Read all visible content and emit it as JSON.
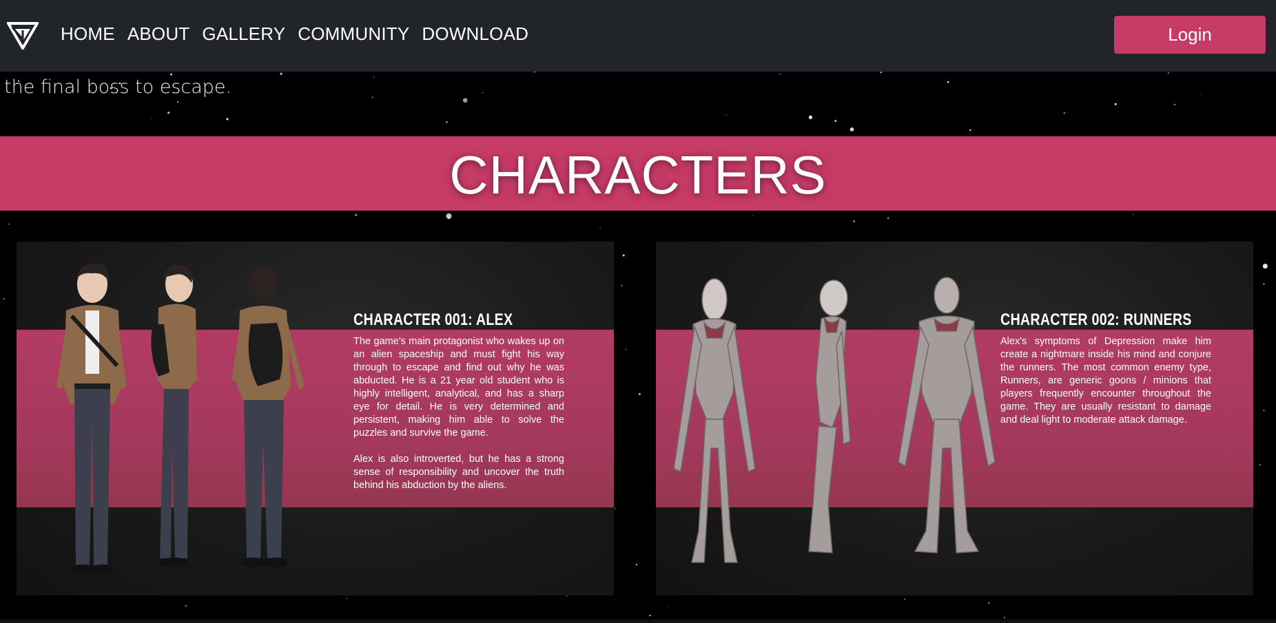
{
  "navbar": {
    "logo_icon": "stylized-triangle-logo-icon",
    "links": [
      "HOME",
      "ABOUT",
      "GALLERY",
      "COMMUNITY",
      "DOWNLOAD"
    ],
    "login_label": "Login"
  },
  "intro": {
    "last_line": "the final boss to escape."
  },
  "characters_section": {
    "heading": "CHARACTERS"
  },
  "cards": [
    {
      "title": "CHARACTER 001: ALEX",
      "paragraphs": [
        "The game's main protagonist who wakes up on an alien spaceship and must fight his way through to escape and find out why he was abducted. He is a 21 year old student who is highly intelligent, analytical, and has a sharp eye for detail. He is very determined and persistent, making him able to solve the puzzles and survive the game.",
        "Alex is also introverted, but he has a strong sense of responsibility and uncover the truth behind his abduction by the aliens."
      ]
    },
    {
      "title": "CHARACTER 002: RUNNERS",
      "paragraphs": [
        "Alex's symptoms of Depression make him create a nightmare inside his mind and conjure the runners. The most common enemy type, Runners, are generic goons / minions that players frequently encounter throughout the game. They are usually resistant to damage and deal light to moderate attack damage."
      ]
    }
  ],
  "colors": {
    "accent": "#c63b66",
    "navbar_bg": "#212529",
    "page_bg": "#000000"
  }
}
